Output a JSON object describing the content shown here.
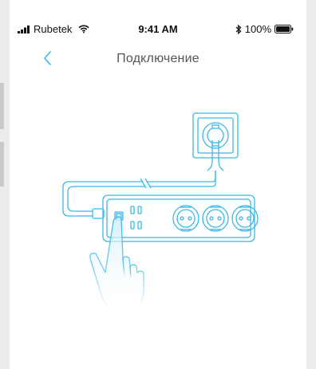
{
  "status_bar": {
    "carrier": "Rubetek",
    "time": "9:41 AM",
    "battery_percent": "100%",
    "signal_icon": "signal-bars-icon",
    "wifi_icon": "wifi-icon",
    "bluetooth_icon": "bluetooth-icon",
    "battery_icon": "battery-icon"
  },
  "nav": {
    "title": "Подключение",
    "back_icon": "chevron-left-icon"
  },
  "colors": {
    "accent": "#39b9e6",
    "title_text": "#555555"
  }
}
